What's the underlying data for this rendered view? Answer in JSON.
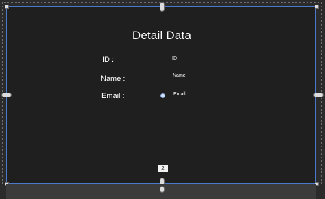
{
  "form": {
    "title": "Detail Data",
    "fields": [
      {
        "label": "ID :",
        "value": "ID"
      },
      {
        "label": "Name :",
        "value": "Name"
      },
      {
        "label": "Email :",
        "value": "Email"
      }
    ]
  },
  "designer": {
    "size_tag": "2"
  },
  "colors": {
    "canvas_bg": "#1f1f1f",
    "frame_border": "#4b78c8",
    "outer_bg": "#2b2b2b"
  }
}
